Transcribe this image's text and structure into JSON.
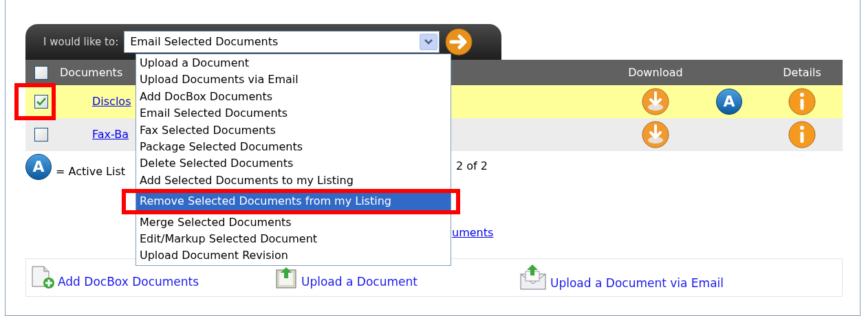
{
  "toolbar": {
    "label": "I would like to:",
    "select_value": "Email Selected Documents",
    "options": [
      {
        "label": "Upload a Document",
        "selected": false,
        "annotated": false
      },
      {
        "label": "Upload Documents via Email",
        "selected": false,
        "annotated": false
      },
      {
        "label": "Add DocBox Documents",
        "selected": false,
        "annotated": false
      },
      {
        "label": "Email Selected Documents",
        "selected": false,
        "annotated": false
      },
      {
        "label": "Fax Selected Documents",
        "selected": false,
        "annotated": false
      },
      {
        "label": "Package Selected Documents",
        "selected": false,
        "annotated": false
      },
      {
        "label": "Delete Selected Documents",
        "selected": false,
        "annotated": false
      },
      {
        "label": "Add Selected Documents to my Listing",
        "selected": false,
        "annotated": false
      },
      {
        "label": "Remove Selected Documents from my Listing",
        "selected": true,
        "annotated": true
      },
      {
        "label": "Merge Selected Documents",
        "selected": false,
        "annotated": false
      },
      {
        "label": "Edit/Markup Selected Document",
        "selected": false,
        "annotated": false
      },
      {
        "label": "Upload Document Revision",
        "selected": false,
        "annotated": false
      }
    ]
  },
  "table": {
    "header_checked": false,
    "columns": [
      "Documents",
      "Download",
      "Details"
    ],
    "rows": [
      {
        "checked": true,
        "annotated": true,
        "name": "Disclos",
        "listing_badge": "A"
      },
      {
        "checked": false,
        "annotated": false,
        "name": "Fax-Ba"
      }
    ]
  },
  "legend": {
    "badge": "A",
    "text": "= Active List"
  },
  "pager": "2 of 2",
  "link": "uments",
  "bottom_links": [
    {
      "kind": "docbox",
      "label": "Add DocBox Documents"
    },
    {
      "kind": "upload",
      "label": "Upload a Document"
    },
    {
      "kind": "email",
      "label": "Upload a Document via Email"
    }
  ]
}
